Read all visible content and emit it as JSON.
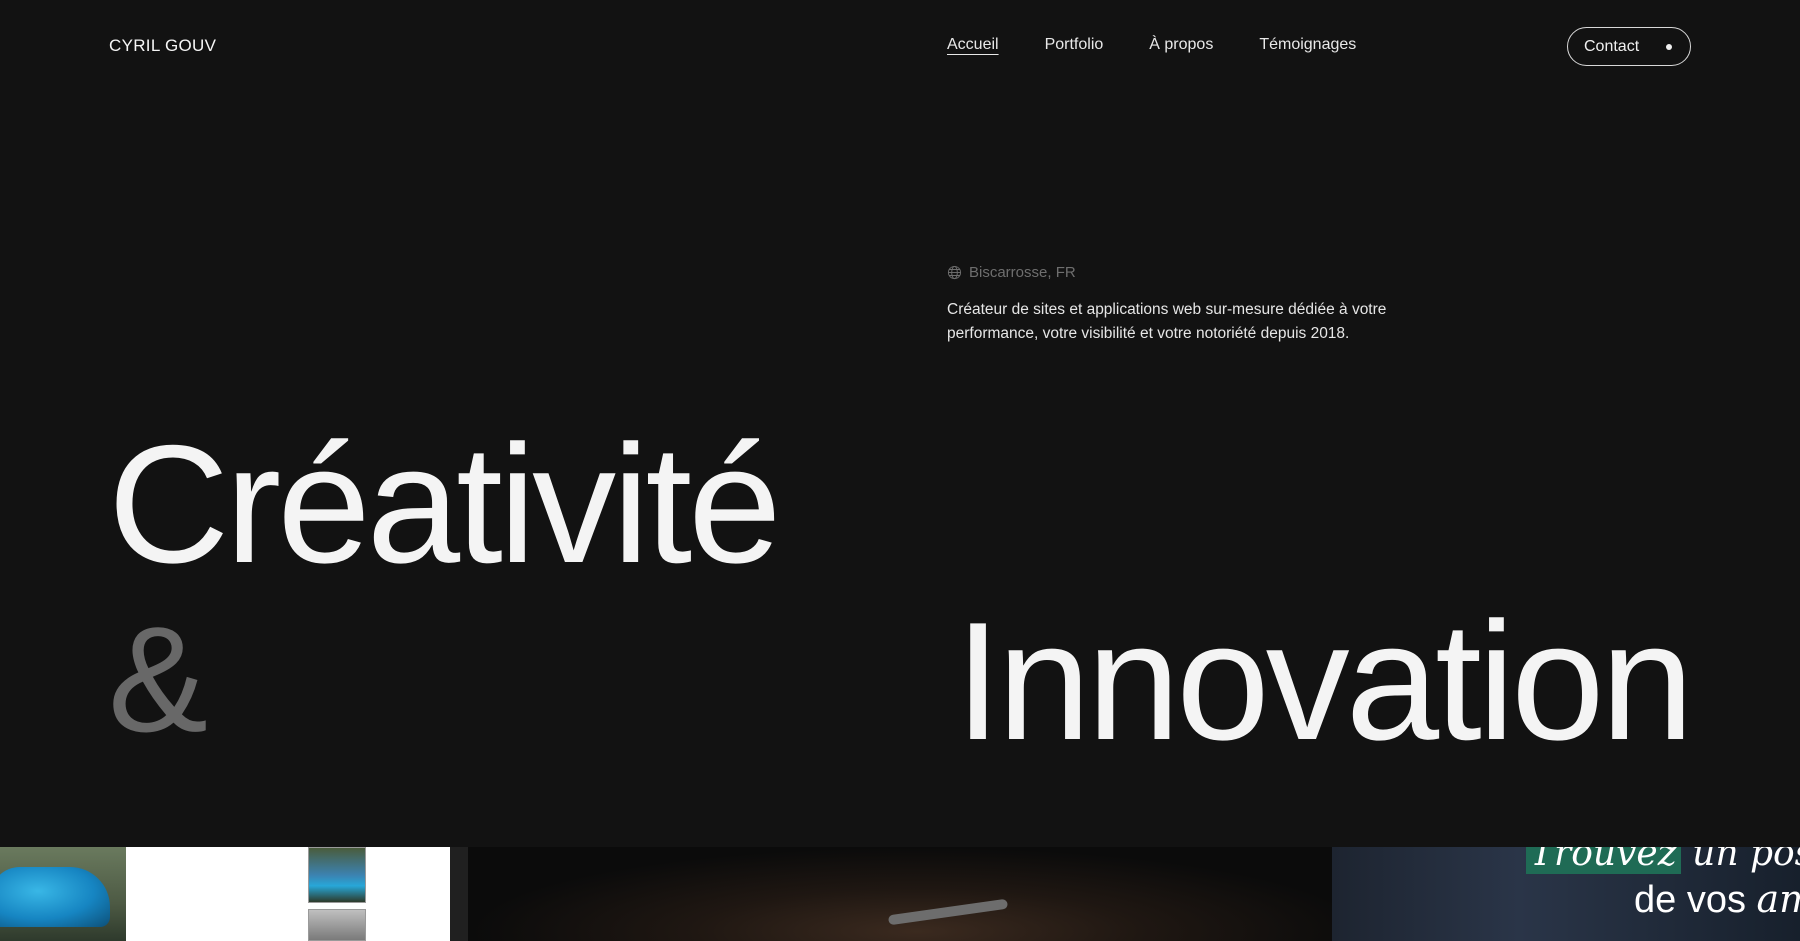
{
  "brand": {
    "name": "CYRIL GOUV"
  },
  "nav": {
    "items": [
      {
        "label": "Accueil",
        "active": true
      },
      {
        "label": "Portfolio",
        "active": false
      },
      {
        "label": "À propos",
        "active": false
      },
      {
        "label": "Témoignages",
        "active": false
      }
    ],
    "contact_label": "Contact"
  },
  "hero": {
    "location": "Biscarrosse, FR",
    "intro": "Créateur de sites et applications web sur-mesure dédiée à votre performance, votre visibilité et votre notoriété depuis 2018.",
    "word_1": "Créativité",
    "ampersand": "&",
    "word_2": "Innovation"
  },
  "projects": {
    "text_tile": {
      "line1_highlight": "Trouvez",
      "line1_rest": " un post",
      "line2_plain": "de vos ",
      "line2_italic": "am"
    }
  },
  "colors": {
    "background": "#121212",
    "text": "#f4f4f4",
    "muted": "#6e6e6e",
    "ampersand": "#686868"
  }
}
